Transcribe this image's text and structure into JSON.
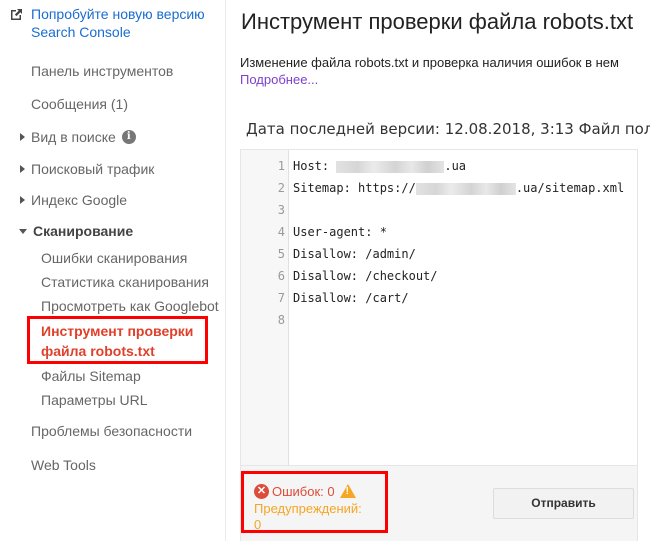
{
  "sidebar": {
    "promo": {
      "icon": "external-link-icon",
      "line1": "Попробуйте новую версию",
      "line2": "Search Console"
    },
    "items": [
      {
        "label": "Панель инструментов"
      },
      {
        "label": "Сообщения (1)"
      },
      {
        "label": "Вид в поиске",
        "expander": "collapsed",
        "info_icon": "info-icon"
      },
      {
        "label": "Поисковый трафик",
        "expander": "collapsed"
      },
      {
        "label": "Индекс Google",
        "expander": "collapsed"
      },
      {
        "label": "Сканирование",
        "expander": "expanded"
      },
      {
        "label": "Проблемы безопасности"
      },
      {
        "label": "Web Tools"
      }
    ],
    "sub_items": [
      {
        "label": "Ошибки сканирования"
      },
      {
        "label": "Статистика сканирования"
      },
      {
        "label": "Просмотреть как Googlebot"
      },
      {
        "label_line1": "Инструмент проверки",
        "label_line2": "файла robots.txt",
        "active": true
      },
      {
        "label": "Файлы Sitemap"
      },
      {
        "label": "Параметры URL"
      }
    ]
  },
  "main": {
    "title": "Инструмент проверки файла robots.txt",
    "description": "Изменение файла robots.txt и проверка наличия ошибок в нем",
    "more_link": "Подробнее...",
    "last_version": "Дата последней версии: 12.08.2018, 3:13 Файл пол",
    "editor": {
      "lines": [
        {
          "n": "1",
          "before": "Host: ",
          "redacted": true,
          "after": ".ua"
        },
        {
          "n": "2",
          "before": "Sitemap: https://",
          "redacted": true,
          "after": ".ua/sitemap.xml"
        },
        {
          "n": "3",
          "text": ""
        },
        {
          "n": "4",
          "text": "User-agent: *"
        },
        {
          "n": "5",
          "text": "Disallow: /admin/"
        },
        {
          "n": "6",
          "text": "Disallow: /checkout/"
        },
        {
          "n": "7",
          "text": "Disallow: /cart/"
        },
        {
          "n": "8",
          "text": ""
        }
      ]
    },
    "status": {
      "errors_label": "Ошибок: 0",
      "warnings_label": "Предупреждений:",
      "warnings_count": "0",
      "error_color": "#dd4b39",
      "warning_color": "#f5a623"
    },
    "submit_label": "Отправить"
  },
  "highlight_color": "#ff0000"
}
